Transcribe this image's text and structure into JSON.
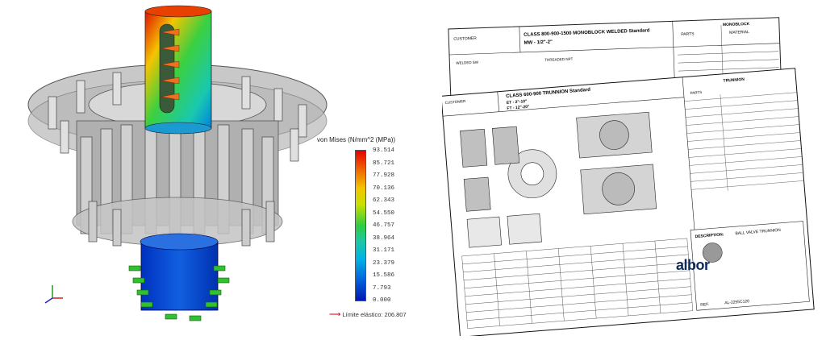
{
  "legend": {
    "title": "von Mises (N/mm^2 (MPa))",
    "ticks": [
      "93.514",
      "85.721",
      "77.928",
      "70.136",
      "62.343",
      "54.550",
      "46.757",
      "38.964",
      "31.171",
      "23.379",
      "15.586",
      "7.793",
      "0.000"
    ],
    "yield_label": "Límite elástico: 206.807",
    "colors": [
      "#e60000",
      "#f4c400",
      "#2ecc40",
      "#00b4e6",
      "#0018b4"
    ]
  },
  "sheet_back": {
    "customer_label": "CUSTOMER",
    "title": "CLASS 800-900-1500 MONOBLOCK WELDED Standard",
    "subtitle": "MW - 1/2\"-2\"",
    "monoblock_label": "MONOBLOCK",
    "parts_label": "PARTS",
    "material_label": "MATERIAL",
    "welded_label": "WELDED SW",
    "threaded_label": "THREADED NPT"
  },
  "sheet_front": {
    "customer_label": "CUSTOMER",
    "title": "CLASS 600-900 TRUNNION Standard",
    "line1": "ET - 2\"-10\"",
    "line2": "FT - 12\"-20\"",
    "trunnion_label": "TRUNNION",
    "parts_label": "PARTS",
    "description_label": "DESCRIPTION:",
    "description_value": "BALL VALVE TRUNNION",
    "logo": "albor",
    "ref_label": "REF.",
    "ref_value": "AL-2255C120"
  }
}
